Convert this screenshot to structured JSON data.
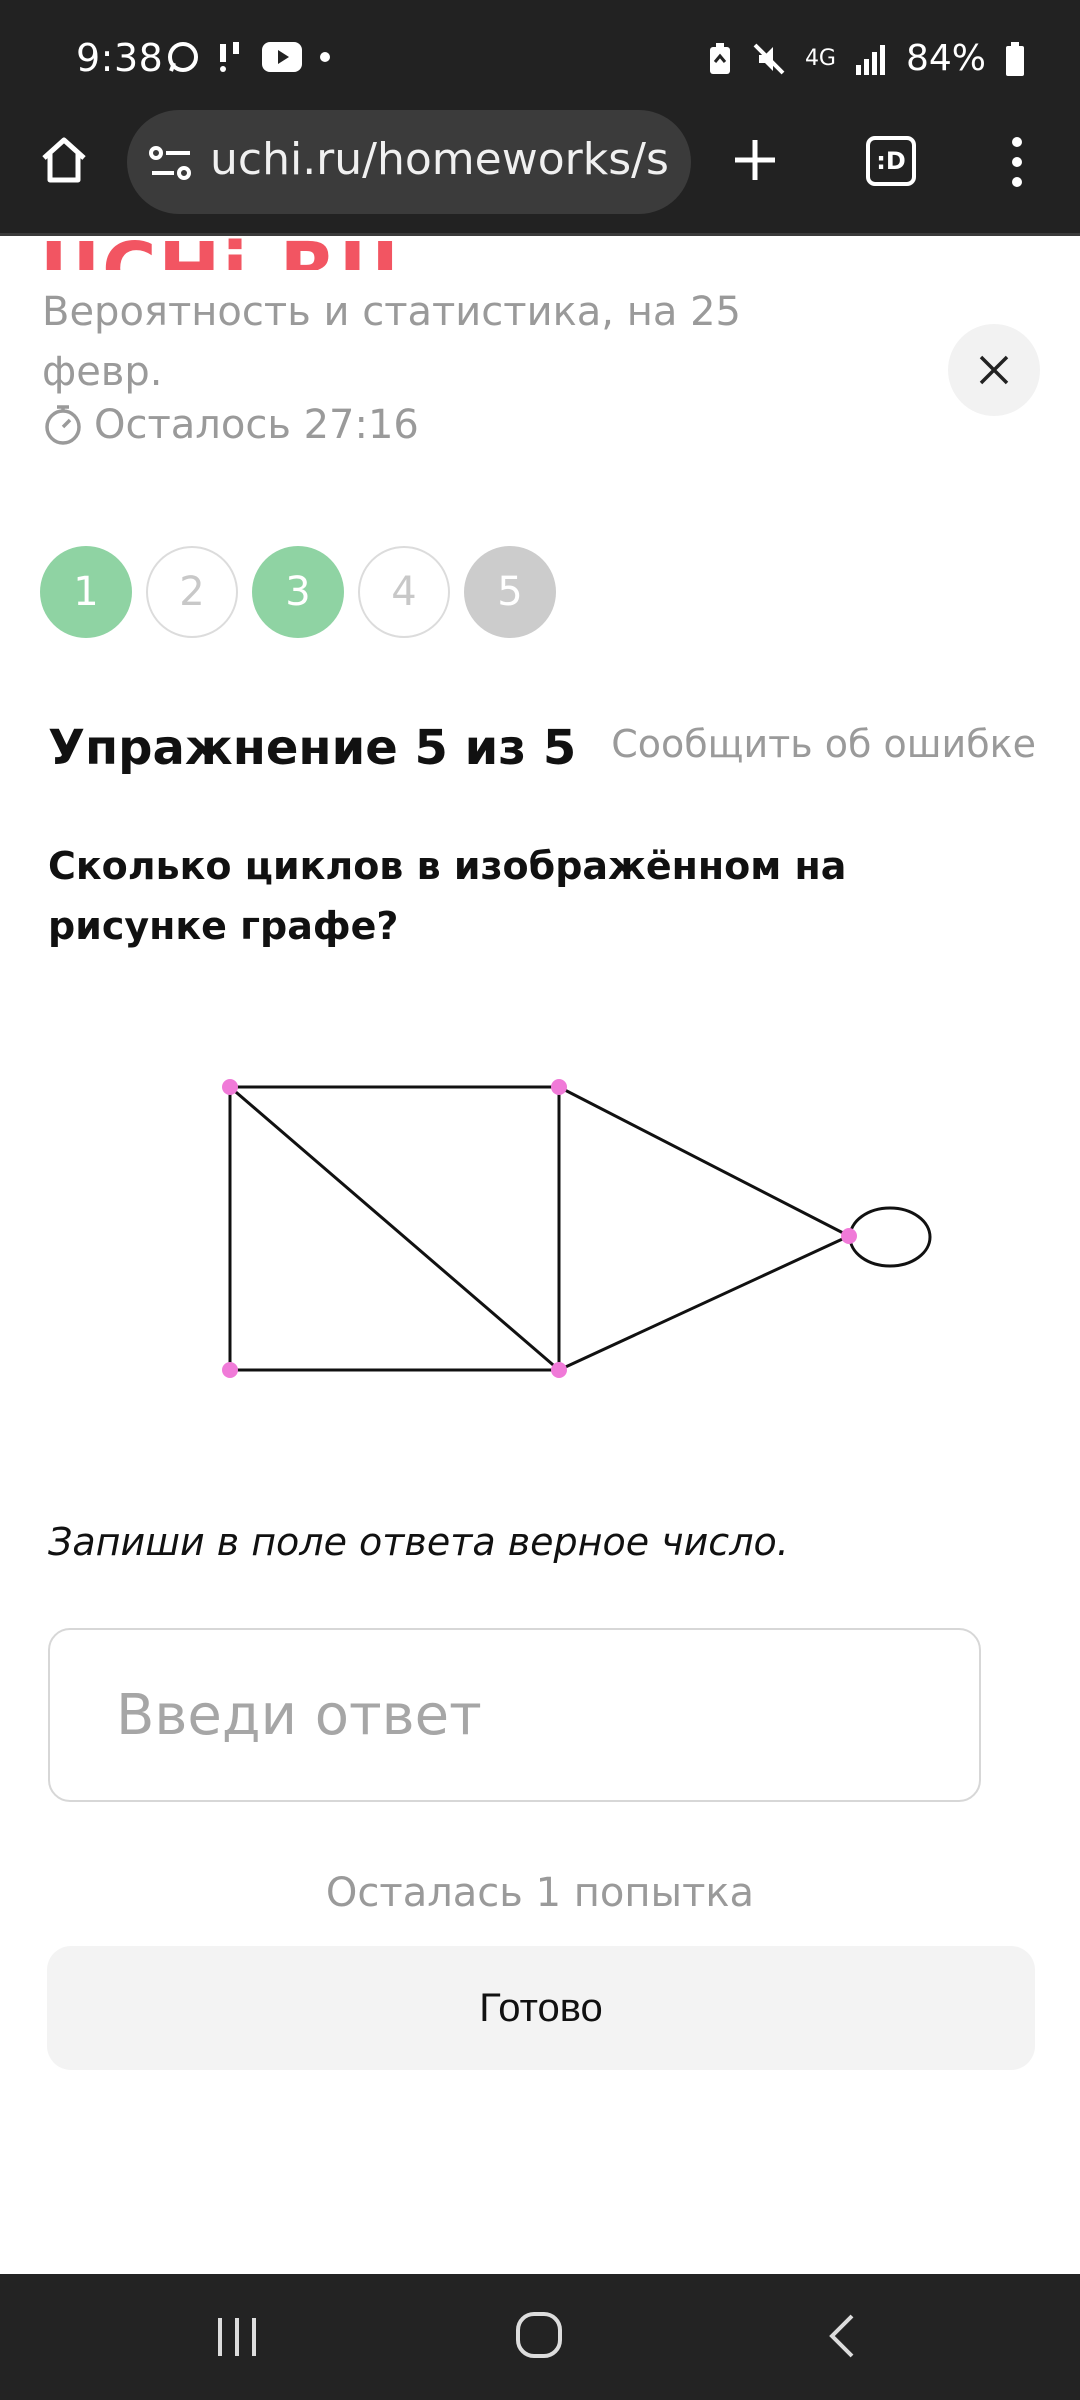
{
  "status_bar": {
    "time": "9:38",
    "network": "4G",
    "battery": "84%",
    "icons": [
      "whatsapp-icon",
      "notification-icon",
      "youtube-icon",
      "dot-icon",
      "battery-saver-icon",
      "mute-icon",
      "network-icon",
      "signal-icon",
      "battery-icon"
    ]
  },
  "browser": {
    "url": "uchi.ru/homeworks/st",
    "icons": [
      "home-icon",
      "site-settings-icon",
      "new-tab-icon",
      "tabs-icon",
      "menu-icon"
    ],
    "tabs_label": ":D"
  },
  "header": {
    "logo": "UCHi.RU",
    "topic": "Вероятность и статистика, на 25 февр.",
    "timer_label": "Осталось 27:16"
  },
  "progress": {
    "steps": [
      {
        "label": "1",
        "state": "done"
      },
      {
        "label": "2",
        "state": "todo"
      },
      {
        "label": "3",
        "state": "done"
      },
      {
        "label": "4",
        "state": "todo"
      },
      {
        "label": "5",
        "state": "current"
      }
    ]
  },
  "exercise": {
    "title": "Упражнение 5 из 5",
    "report_link": "Сообщить об ошибке",
    "question": "Сколько циклов в изображённом на рисунке графе?",
    "instruction": "Запиши в поле ответа верное число.",
    "answer_value": "",
    "answer_placeholder": "Введи ответ",
    "attempts": "Осталась 1 попытка",
    "submit_label": "Готово"
  },
  "graph": {
    "vertex_color": "#f07ad8",
    "edge_color": "#111111"
  },
  "colors": {
    "brand": "#f25562",
    "done": "#8fd3a3",
    "current": "#cccccc"
  }
}
